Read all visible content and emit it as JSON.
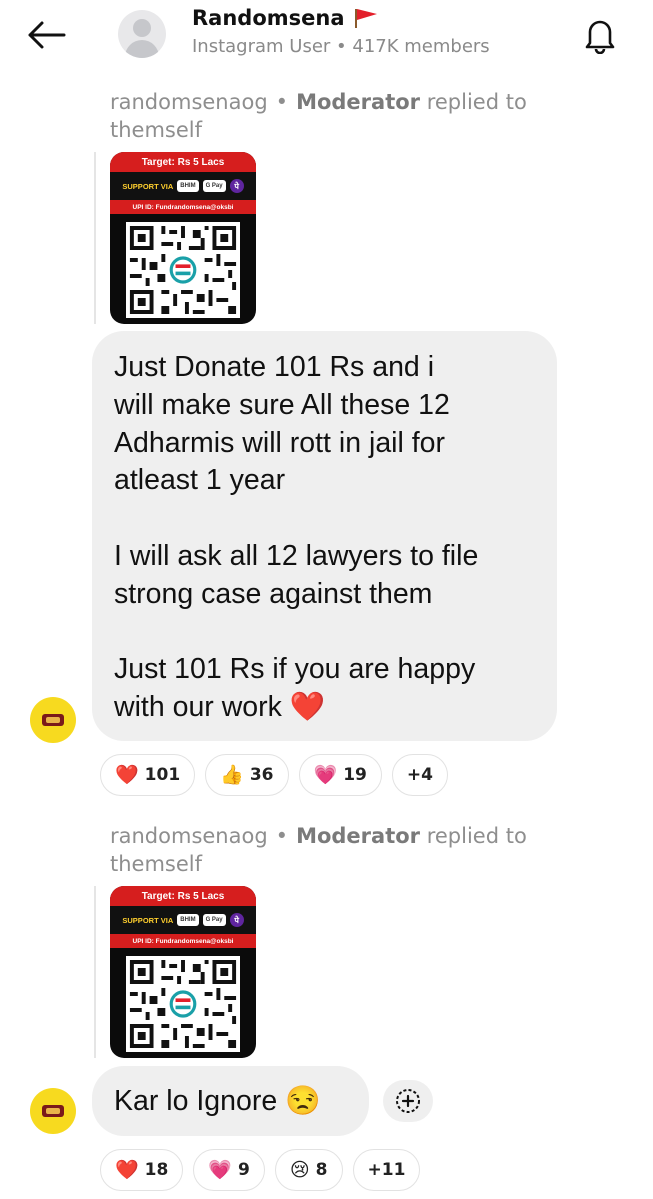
{
  "header": {
    "title": "Randomsena",
    "subtitle": "Instagram User • 417K members"
  },
  "colors": {
    "poster_red": "#d61e1e",
    "avatar_yellow": "#f7da1f",
    "bubble_grey": "#efefef"
  },
  "icons": [
    "back-arrow-icon",
    "default-avatar-icon",
    "red-flag-icon",
    "bell-icon",
    "add-reaction-icon",
    "channel-logo-icon"
  ],
  "messages": [
    {
      "reply_author": "randomsenaog",
      "reply_dot": "•",
      "reply_role": "Moderator",
      "reply_action": "replied to",
      "reply_target": "themself",
      "poster": {
        "target": "Target: Rs 5 Lacs",
        "support": "SUPPORT VIA",
        "pay_chip_1": "BHIM",
        "pay_chip_2": "G Pay",
        "pay_chip_3": "पे",
        "upi": "UPI ID: Fundrandomsena@oksbi"
      },
      "text": "Just Donate 101 Rs and i\nwill make sure All these 12\nAdharmis will rott in jail for\natleast 1 year\n\nI will ask all 12 lawyers to file\nstrong case against them\n\nJust 101 Rs if you are happy\nwith our work ❤️",
      "reactions": [
        {
          "emoji": "❤️",
          "count": "101"
        },
        {
          "emoji": "👍",
          "count": "36"
        },
        {
          "emoji": "💗",
          "count": "19"
        },
        {
          "emoji": "",
          "count": "+4"
        }
      ]
    },
    {
      "reply_author": "randomsenaog",
      "reply_dot": "•",
      "reply_role": "Moderator",
      "reply_action": "replied to",
      "reply_target": "themself",
      "poster": {
        "target": "Target: Rs 5 Lacs",
        "support": "SUPPORT VIA",
        "pay_chip_1": "BHIM",
        "pay_chip_2": "G Pay",
        "pay_chip_3": "पे",
        "upi": "UPI ID: Fundrandomsena@oksbi"
      },
      "text": "Kar lo Ignore 😒",
      "reactions": [
        {
          "emoji": "❤️",
          "count": "18"
        },
        {
          "emoji": "💗",
          "count": "9"
        },
        {
          "emoji": "😢",
          "count": "8"
        },
        {
          "emoji": "",
          "count": "+11"
        }
      ]
    }
  ]
}
